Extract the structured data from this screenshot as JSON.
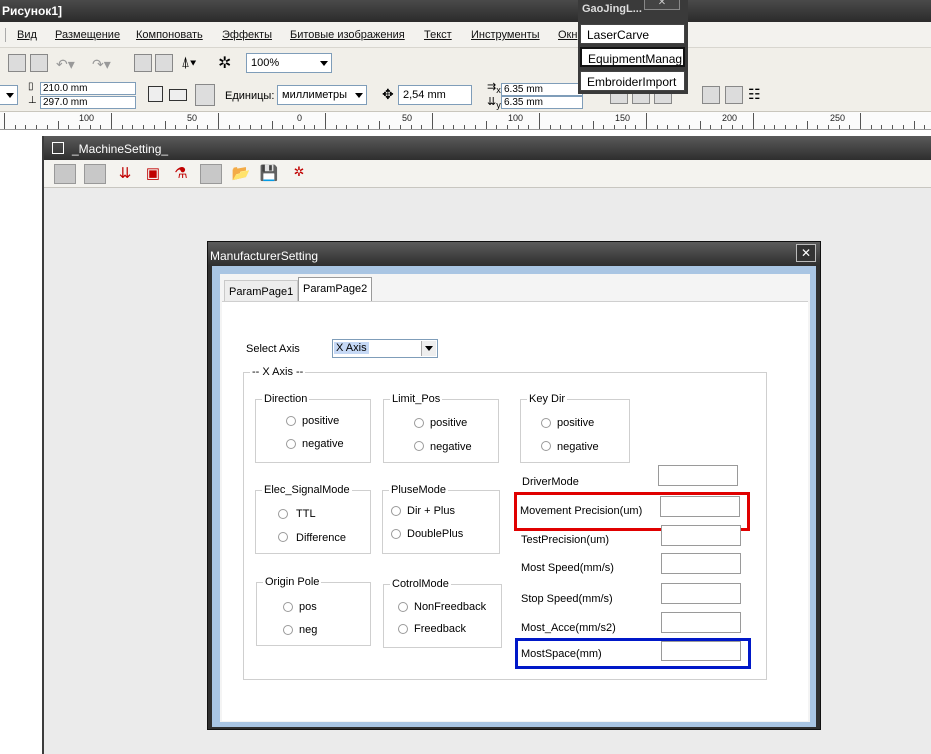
{
  "app": {
    "title": "Рисунок1]"
  },
  "menu": [
    "Вид",
    "Размещение",
    "Компоновать",
    "Эффекты",
    "Битовые изображения",
    "Текст",
    "Инструменты",
    "Окн"
  ],
  "toolbar": {
    "zoom": "100%"
  },
  "propbar": {
    "width": "210.0 mm",
    "height": "297.0 mm",
    "units_label": "Единицы:",
    "units_value": "миллиметры",
    "nudge": "2,54 mm",
    "dup_x": "6.35 mm",
    "dup_y": "6.35 mm",
    "x_sub": "x",
    "y_sub": "y"
  },
  "ruler": {
    "labels": [
      "100",
      "50",
      "0",
      "50",
      "100",
      "150",
      "200",
      "250"
    ]
  },
  "popup": {
    "title": "GaoJingL...",
    "items": [
      "LaserCarve",
      "EquipmentManag",
      "EmbroiderImport"
    ]
  },
  "machine_window": {
    "title": "_MachineSetting_"
  },
  "dialog": {
    "title": "ManufacturerSetting",
    "close": "✕",
    "tabs": [
      "ParamPage1",
      "ParamPage2"
    ],
    "select_axis_label": "Select Axis",
    "select_axis_value": "X Axis",
    "axis_group": "-- X Axis --",
    "direction": {
      "title": "Direction",
      "options": [
        "positive",
        "negative"
      ]
    },
    "limit_pos": {
      "title": "Limit_Pos",
      "options": [
        "positive",
        "negative"
      ]
    },
    "key_dir": {
      "title": "Key Dir",
      "options": [
        "positive",
        "negative"
      ]
    },
    "elec_signal": {
      "title": "Elec_SignalMode",
      "options": [
        "TTL",
        "Difference"
      ]
    },
    "pulse_mode": {
      "title": "PluseMode",
      "options": [
        "Dir + Plus",
        "DoublePlus"
      ]
    },
    "origin_pole": {
      "title": "Origin Pole",
      "options": [
        "pos",
        "neg"
      ]
    },
    "control_mode": {
      "title": "CotrolMode",
      "options": [
        "NonFreedback",
        "Freedback"
      ]
    },
    "fields": [
      "DriverMode",
      "Movement Precision(um)",
      "TestPrecision(um)",
      "Most Speed(mm/s)",
      "Stop Speed(mm/s)",
      "Most_Acce(mm/s2)",
      "MostSpace(mm)"
    ]
  },
  "colors": {
    "highlight_red": "#e00000",
    "highlight_blue": "#0018c8"
  }
}
